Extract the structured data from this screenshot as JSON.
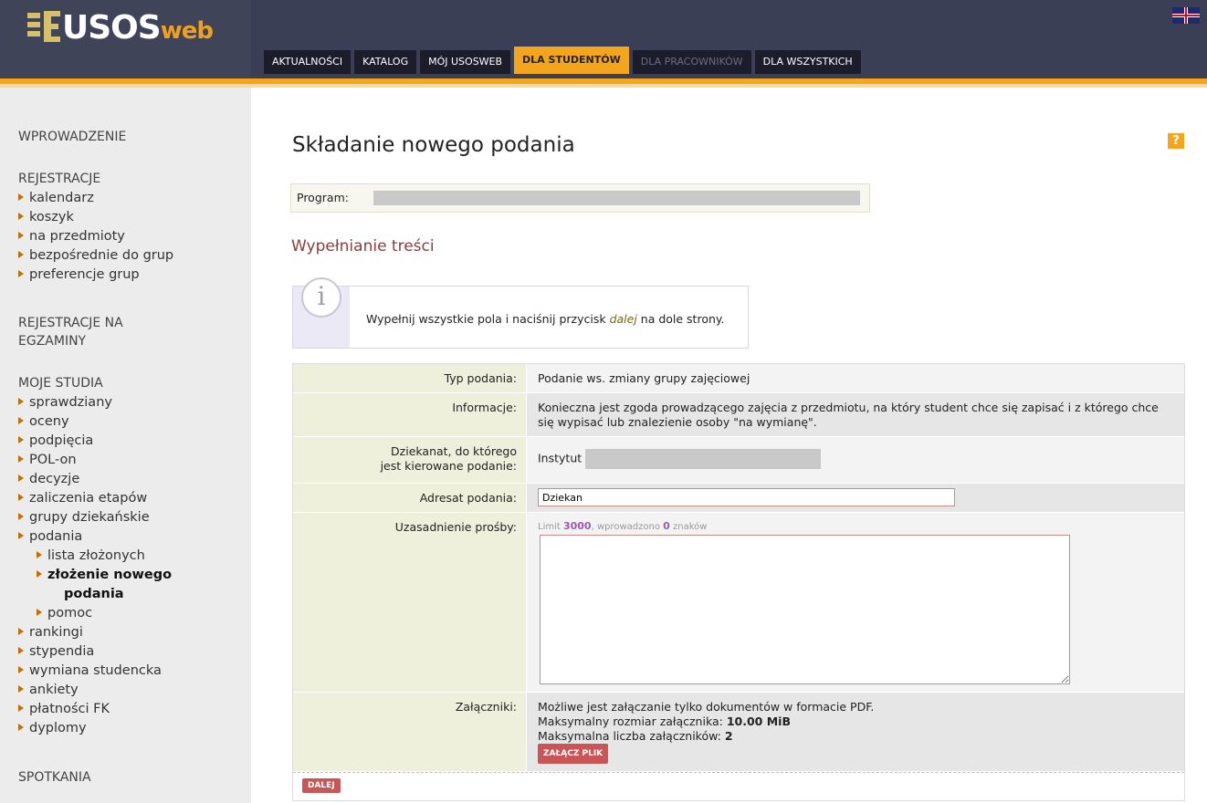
{
  "header": {
    "logo_text": "USOS",
    "logo_suffix": "web",
    "tabs": [
      {
        "label": "AKTUALNOŚCI",
        "state": "normal"
      },
      {
        "label": "KATALOG",
        "state": "normal"
      },
      {
        "label": "MÓJ USOSWEB",
        "state": "normal"
      },
      {
        "label": "DLA STUDENTÓW",
        "state": "active"
      },
      {
        "label": "DLA PRACOWNIKÓW",
        "state": "disabled"
      },
      {
        "label": "DLA WSZYSTKICH",
        "state": "normal"
      }
    ],
    "flag_icon": "uk-flag-icon"
  },
  "sidebar": {
    "sections": [
      {
        "label": "WPROWADZENIE",
        "items": []
      },
      {
        "label": "REJESTRACJE",
        "items": [
          "kalendarz",
          "koszyk",
          "na przedmioty",
          "bezpośrednie do grup",
          "preferencje grup"
        ]
      },
      {
        "label": "REJESTRACJE NA EGZAMINY",
        "items": []
      },
      {
        "label": "MOJE STUDIA",
        "items": [
          "sprawdziany",
          "oceny",
          "podpięcia",
          "POL-on",
          "decyzje",
          "zaliczenia etapów",
          "grupy dziekańskie",
          "podania"
        ]
      },
      {
        "label": "SPOTKANIA",
        "items": []
      }
    ],
    "podania_sub": [
      "lista złożonych",
      "złożenie nowego podania",
      "pomoc"
    ],
    "more_items": [
      "rankingi",
      "stypendia",
      "wymiana studencka",
      "ankiety",
      "płatności FK",
      "dyplomy"
    ],
    "section_reg_exam_line1": "REJESTRACJE NA",
    "section_reg_exam_line2": "EGZAMINY",
    "current_line1": "złożenie nowego",
    "current_line2": "podania"
  },
  "main": {
    "help_icon": "?",
    "title": "Składanie nowego podania",
    "program_label": "Program:",
    "section_title": "Wypełnianie treści",
    "info_icon": "i",
    "info_text_before": "Wypełnij wszystkie pola i naciśnij przycisk ",
    "info_text_em": "dalej",
    "info_text_after": " na dole strony.",
    "form": {
      "typ_label": "Typ podania:",
      "typ_value": "Podanie ws. zmiany grupy zajęciowej",
      "info_label": "Informacje:",
      "info_value": "Konieczna jest zgoda prowadzącego zajęcia z przedmiotu, na który student chce się zapisać i z którego chce się wypisać lub znalezienie osoby \"na wymianę\".",
      "dziekanat_label_line1": "Dziekanat, do którego",
      "dziekanat_label_line2": "jest kierowane podanie:",
      "dziekanat_value": "Instytut",
      "adresat_label": "Adresat podania:",
      "adresat_value": "Dziekan",
      "uzasadnienie_label": "Uzasadnienie prośby:",
      "limit_prefix": "Limit ",
      "limit_value": "3000",
      "limit_mid": ", wprowadzono ",
      "limit_count": "0",
      "limit_suffix": " znaków",
      "reason_value": "",
      "zalaczniki_label": "Załączniki:",
      "zal_line1": "Możliwe jest załączanie tylko dokumentów w formacie PDF.",
      "zal_line2_prefix": "Maksymalny rozmiar załącznika: ",
      "zal_line2_value": "10.00 MiB",
      "zal_line3_prefix": "Maksymalna liczba załączników: ",
      "zal_line3_value": "2",
      "attach_button": "ZAŁĄCZ PLIK",
      "next_button": "DALEJ"
    }
  }
}
